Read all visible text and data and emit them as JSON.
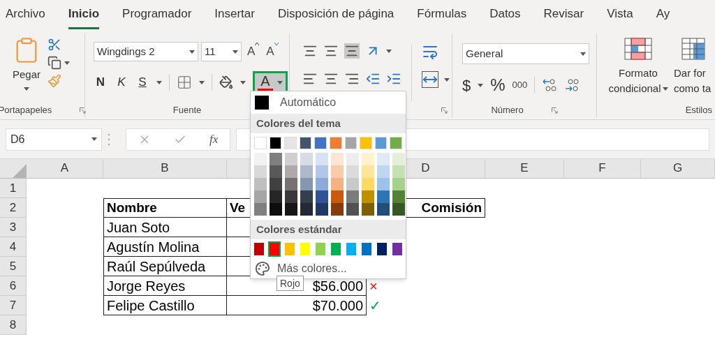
{
  "tabs": [
    {
      "label": "Archivo",
      "selected": false
    },
    {
      "label": "Inicio",
      "selected": true
    },
    {
      "label": "Programador",
      "selected": false
    },
    {
      "label": "Insertar",
      "selected": false
    },
    {
      "label": "Disposición de página",
      "selected": false
    },
    {
      "label": "Fórmulas",
      "selected": false
    },
    {
      "label": "Datos",
      "selected": false
    },
    {
      "label": "Revisar",
      "selected": false
    },
    {
      "label": "Vista",
      "selected": false
    },
    {
      "label": "Ay",
      "selected": false
    }
  ],
  "ribbon": {
    "clipboard": {
      "paste_label": "Pegar",
      "group_label": "Portapapeles"
    },
    "font": {
      "font_name": "Wingdings 2",
      "font_size": "11",
      "grow_label": "A",
      "shrink_label": "A",
      "bold_label": "N",
      "italic_label": "K",
      "underline_label": "S",
      "font_color_label": "A",
      "font_color_open": true,
      "group_label": "Fuente"
    },
    "number": {
      "format": "General",
      "currency_label": "$",
      "percent_label": "%",
      "thousands_label": "000",
      "group_label": "Número"
    },
    "styles": {
      "conditional_label_1": "Formato",
      "conditional_label_2": "condicional",
      "table_label_1": "Dar for",
      "table_label_2": "como ta",
      "group_label": "Estilos"
    }
  },
  "formula_bar": {
    "name_box": "D6",
    "fx_label": "fx"
  },
  "sheet": {
    "columns": [
      "A",
      "B",
      null,
      "D",
      "E",
      "F",
      "G"
    ],
    "rows": [
      {
        "number": "1",
        "cells": [
          null,
          null,
          null,
          null,
          null,
          null,
          null
        ]
      },
      {
        "number": "2",
        "cells": [
          null,
          {
            "text": "Nombre",
            "bold": true,
            "border": true
          },
          {
            "text": "Ve",
            "bold": true,
            "border": true
          },
          {
            "text": "Comisión",
            "bold": true,
            "border": true,
            "right_aligned": true
          },
          null,
          null,
          null
        ]
      },
      {
        "number": "3",
        "cells": [
          null,
          {
            "text": "Juan Soto",
            "bold": false,
            "border": true
          },
          {
            "border": true
          },
          null,
          null,
          null,
          null
        ]
      },
      {
        "number": "4",
        "cells": [
          null,
          {
            "text": "Agustín Molina",
            "bold": false,
            "border": true
          },
          {
            "border": true
          },
          null,
          null,
          null,
          null
        ]
      },
      {
        "number": "5",
        "cells": [
          null,
          {
            "text": "Raúl Sepúlveda",
            "bold": false,
            "border": true
          },
          {
            "border": true
          },
          null,
          null,
          null,
          null
        ]
      },
      {
        "number": "6",
        "cells": [
          null,
          {
            "text": "Jorge Reyes",
            "bold": false,
            "border": true
          },
          {
            "text": "$56.000",
            "bold": false,
            "border": true,
            "right_aligned": true
          },
          {
            "text": "×",
            "bold": false,
            "border": false,
            "color": "#ff0000"
          },
          null,
          null,
          null
        ]
      },
      {
        "number": "7",
        "cells": [
          null,
          {
            "text": "Felipe Castillo",
            "bold": false,
            "border": true
          },
          {
            "text": "$70.000",
            "bold": false,
            "border": true,
            "right_aligned": true
          },
          {
            "text": "✓",
            "bold": false,
            "border": false,
            "color": "#00b050"
          },
          null,
          null,
          null
        ]
      },
      {
        "number": "8",
        "cells": [
          null,
          null,
          null,
          null,
          null,
          null,
          null
        ]
      }
    ]
  },
  "color_menu": {
    "automatic": {
      "label": "Automático",
      "color": "#000000"
    },
    "theme_title": "Colores del tema",
    "theme_colors": [
      {
        "color": "#ffffff",
        "shades": [
          {
            "color": "#f2f2f2"
          },
          {
            "color": "#d9d9d9"
          },
          {
            "color": "#bfbfbf"
          },
          {
            "color": "#a6a6a6"
          },
          {
            "color": "#808080"
          }
        ]
      },
      {
        "color": "#000000",
        "shades": [
          {
            "color": "#7f7f7f"
          },
          {
            "color": "#595959"
          },
          {
            "color": "#404040"
          },
          {
            "color": "#262626"
          },
          {
            "color": "#0d0d0d"
          }
        ]
      },
      {
        "color": "#e7e6e6",
        "shades": [
          {
            "color": "#d0cece"
          },
          {
            "color": "#aeaaaa"
          },
          {
            "color": "#757171"
          },
          {
            "color": "#3a3838"
          },
          {
            "color": "#171616"
          }
        ]
      },
      {
        "color": "#44546a",
        "shades": [
          {
            "color": "#d6dce4"
          },
          {
            "color": "#adb9ca"
          },
          {
            "color": "#8497b0"
          },
          {
            "color": "#333f4f"
          },
          {
            "color": "#222a35"
          }
        ]
      },
      {
        "color": "#4472c4",
        "shades": [
          {
            "color": "#d9e2f3"
          },
          {
            "color": "#b4c6e7"
          },
          {
            "color": "#8eaadb"
          },
          {
            "color": "#2f5496"
          },
          {
            "color": "#1f3864"
          }
        ]
      },
      {
        "color": "#ed7d31",
        "shades": [
          {
            "color": "#fbe5d5"
          },
          {
            "color": "#f7cbac"
          },
          {
            "color": "#f4b183"
          },
          {
            "color": "#c55a11"
          },
          {
            "color": "#833c0b"
          }
        ]
      },
      {
        "color": "#a5a5a5",
        "shades": [
          {
            "color": "#ededed"
          },
          {
            "color": "#dbdbdb"
          },
          {
            "color": "#c9c9c9"
          },
          {
            "color": "#7b7b7b"
          },
          {
            "color": "#525252"
          }
        ]
      },
      {
        "color": "#ffc000",
        "shades": [
          {
            "color": "#fff2cc"
          },
          {
            "color": "#fee599"
          },
          {
            "color": "#ffd965"
          },
          {
            "color": "#bf9000"
          },
          {
            "color": "#7f6000"
          }
        ]
      },
      {
        "color": "#5b9bd5",
        "shades": [
          {
            "color": "#deebf6"
          },
          {
            "color": "#bdd7ee"
          },
          {
            "color": "#9cc3e5"
          },
          {
            "color": "#2e75b5"
          },
          {
            "color": "#1e4e79"
          }
        ]
      },
      {
        "color": "#70ad47",
        "shades": [
          {
            "color": "#e2efd9"
          },
          {
            "color": "#c5e0b3"
          },
          {
            "color": "#a8d08d"
          },
          {
            "color": "#538135"
          },
          {
            "color": "#375623"
          }
        ]
      }
    ],
    "standard_title": "Colores estándar",
    "standard_colors": [
      {
        "color": "#c00000",
        "selected": false
      },
      {
        "color": "#ff0000",
        "selected": true
      },
      {
        "color": "#ffc000",
        "selected": false
      },
      {
        "color": "#ffff00",
        "selected": false
      },
      {
        "color": "#92d050",
        "selected": false
      },
      {
        "color": "#00b050",
        "selected": false
      },
      {
        "color": "#00b0f0",
        "selected": false
      },
      {
        "color": "#0070c0",
        "selected": false
      },
      {
        "color": "#002060",
        "selected": false
      },
      {
        "color": "#7030a0",
        "selected": false
      }
    ],
    "more_colors_label": "Más colores...",
    "tooltip": "Rojo"
  }
}
